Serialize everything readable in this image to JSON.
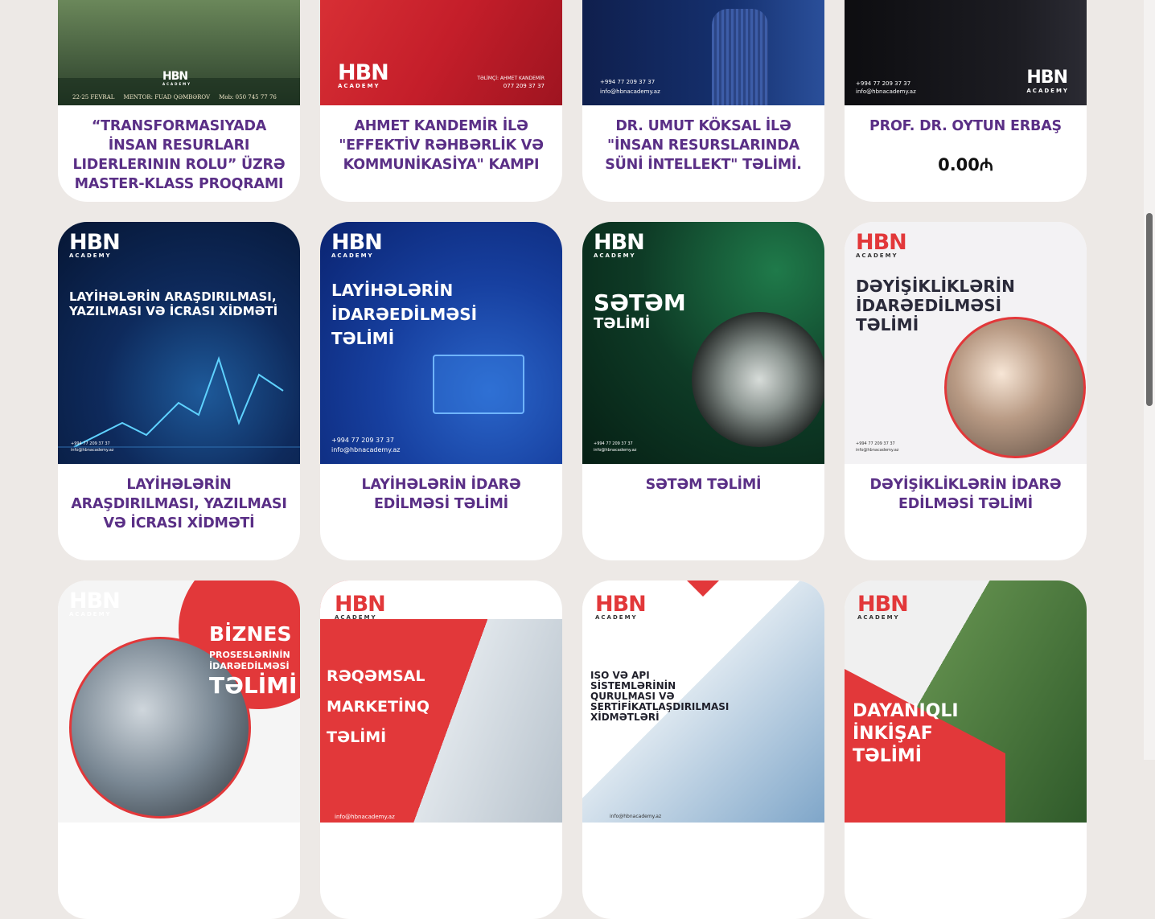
{
  "cards": [
    {
      "title": "“TRANSFORMASIYADA İNSAN RESURLARI LIDERLERININ ROLU” ÜZRƏ MASTER-KLASS PROQRAMI",
      "img": {
        "top_line": "22-25 FEVRAL     MENTOR: FUAD QƏMBƏROV     Mob: 050 745 77 76",
        "logo": "HBN",
        "logo_sub": "ACADEMY"
      }
    },
    {
      "title": "AHMET KANDEMİR İLƏ \"EFFEKTİV RƏHBƏRLİK VƏ KOMMUNİKASİYA\" KAMPI",
      "img": {
        "logo": "HBN",
        "logo_sub": "ACADEMY",
        "line1": "TƏLİMÇİ: AHMET KANDEMİR",
        "line2": "077 209 37 37"
      }
    },
    {
      "title": "DR. UMUT KÖKSAL İLƏ \"İNSAN RESURSLARINDA SÜNİ İNTELLEKT\" TƏLİMİ.",
      "img": {
        "phone": "+994 77 209 37 37",
        "email": "info@hbnacademy.az"
      }
    },
    {
      "title": "PROF. DR. OYTUN ERBAŞ",
      "price": "0.00₼",
      "img": {
        "phone": "+994 77 209 37 37",
        "email": "info@hbnacademy.az",
        "logo": "HBN",
        "logo_sub": "ACADEMY"
      }
    },
    {
      "title": "LAYİHƏLƏRİN ARAŞDIRILMASI, YAZILMASI VƏ İCRASI XİDMƏTİ",
      "img": {
        "logo": "HBN",
        "logo_sub": "ACADEMY",
        "headline": "LAYİHƏLƏRİN ARAŞDIRILMASI, YAZILMASI VƏ İCRASI XİDMƏTİ",
        "phone": "+994 77 209 37 37",
        "email": "info@hbnacademy.az"
      }
    },
    {
      "title": "LAYİHƏLƏRİN İDARƏ EDİLMƏSİ TƏLİMİ",
      "img": {
        "logo": "HBN",
        "logo_sub": "ACADEMY",
        "headline": "LAYİHƏLƏRİN İDARƏEDİLMƏSİ TƏLİMİ",
        "phone": "+994 77 209 37 37",
        "email": "info@hbnacademy.az"
      }
    },
    {
      "title": "SƏTƏM TƏLİMİ",
      "img": {
        "logo": "HBN",
        "logo_sub": "ACADEMY",
        "headline1": "SƏTƏM",
        "headline2": "TƏLİMİ",
        "phone": "+994 77 209 37 37",
        "email": "info@hbnacademy.az"
      }
    },
    {
      "title": "DƏYİŞİKLİKLƏRİN İDARƏ EDİLMƏSİ TƏLİMİ",
      "img": {
        "logo": "HBN",
        "logo_sub": "ACADEMY",
        "headline": "DƏYİŞİKLİKLƏRİN İDARƏEDİLMƏSİ TƏLİMİ",
        "phone": "+994 77 209 37 37",
        "email": "info@hbnacademy.az"
      }
    },
    {
      "title": "",
      "img": {
        "logo": "HBN",
        "logo_sub": "ACADEMY",
        "h1": "BİZNES",
        "h2": "PROSESLƏRİNİN",
        "h3": "İDARƏEDİLMƏSİ",
        "h4": "TƏLİMİ"
      }
    },
    {
      "title": "",
      "img": {
        "logo": "HBN",
        "logo_sub": "ACADEMY",
        "h1": "RƏQƏMSAL",
        "h2": "MARKETİNQ",
        "h3": "TƏLİMİ",
        "email": "info@hbnacademy.az"
      }
    },
    {
      "title": "",
      "img": {
        "logo": "HBN",
        "logo_sub": "ACADEMY",
        "headline": "ISO VƏ API SİSTEMLƏRİNİN QURULMASI VƏ SERTİFİKATLAŞDIRILMASI XİDMƏTLƏRİ",
        "email": "info@hbnacademy.az"
      }
    },
    {
      "title": "",
      "img": {
        "logo": "HBN",
        "logo_sub": "ACADEMY",
        "h1": "DAYANIQLI",
        "h2": "İNKİŞAF",
        "h3": "TƏLİMİ"
      }
    }
  ],
  "colors": {
    "title": "#5a2f86",
    "red": "#e2383a",
    "blue": "#1a2a7a",
    "green": "#0e3b26"
  }
}
